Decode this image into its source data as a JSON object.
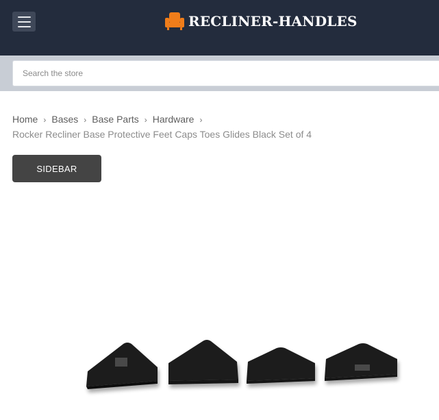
{
  "header": {
    "logo_text": "RECLINER-HANDLES",
    "brand_color": "#f07d1a",
    "background_color": "#232c3d",
    "menu_icon": "hamburger-icon",
    "logo_icon": "armchair-icon"
  },
  "search": {
    "placeholder": "Search the store"
  },
  "breadcrumb": {
    "items": [
      "Home",
      "Bases",
      "Base Parts",
      "Hardware"
    ],
    "current": "Rocker Recliner Base Protective Feet Caps Toes Glides Black Set of 4",
    "separator_icon": "chevron-right-icon"
  },
  "sidebar_button": {
    "label": "SIDEBAR"
  },
  "product": {
    "image_description_icon": "product-photo"
  }
}
